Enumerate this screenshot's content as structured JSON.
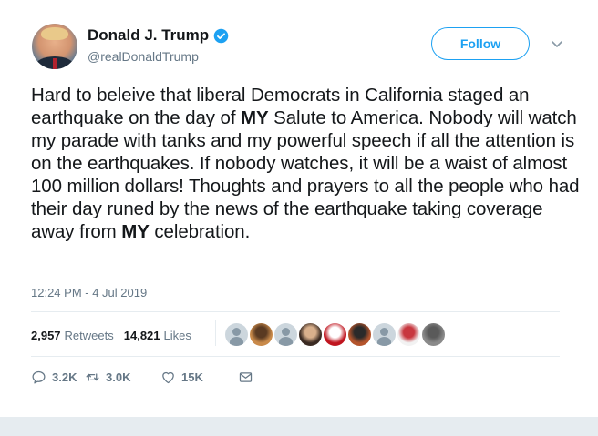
{
  "user": {
    "name": "Donald J. Trump",
    "handle": "@realDonaldTrump"
  },
  "follow_label": "Follow",
  "tweet": {
    "segments": [
      {
        "text": "Hard to beleive that liberal Democrats in California staged an earthquake on the day of ",
        "bold": false
      },
      {
        "text": "MY",
        "bold": true
      },
      {
        "text": " Salute to America. Nobody will watch my parade with tanks and my powerful speech if all the attention is on the earthquakes. If nobody watches, it will be a waist of almost 100 million dollars! Thoughts and prayers to all the people who had their day runed by the news of the earthquake taking coverage away from ",
        "bold": false
      },
      {
        "text": "MY",
        "bold": true
      },
      {
        "text": " celebration.",
        "bold": false
      }
    ],
    "timestamp": "12:24 PM - 4 Jul 2019"
  },
  "stats": {
    "retweets_count": "2,957",
    "retweets_label": "Retweets",
    "likes_count": "14,821",
    "likes_label": "Likes"
  },
  "likers": [
    {
      "kind": "default"
    },
    {
      "kind": "photo",
      "colors": [
        "#c98a4a",
        "#5a3a22"
      ]
    },
    {
      "kind": "default"
    },
    {
      "kind": "photo",
      "colors": [
        "#3a2a22",
        "#d9b08c"
      ]
    },
    {
      "kind": "photo",
      "colors": [
        "#c0151f",
        "#ffffff"
      ]
    },
    {
      "kind": "photo",
      "colors": [
        "#b4542c",
        "#2a2a2a"
      ]
    },
    {
      "kind": "default"
    },
    {
      "kind": "photo",
      "colors": [
        "#f2f2f2",
        "#c8373f"
      ]
    },
    {
      "kind": "photo",
      "colors": [
        "#8a8a8a",
        "#5a5a5a"
      ]
    }
  ],
  "actions": {
    "reply_count": "3.2K",
    "retweet_count": "3.0K",
    "like_count": "15K"
  },
  "colors": {
    "accent": "#1da1f2",
    "text": "#14171a",
    "secondary": "#657786",
    "divider": "#e6ecf0"
  },
  "icons": [
    "verified-badge-icon",
    "chevron-down-icon",
    "reply-icon",
    "retweet-icon",
    "heart-icon",
    "direct-message-icon"
  ]
}
